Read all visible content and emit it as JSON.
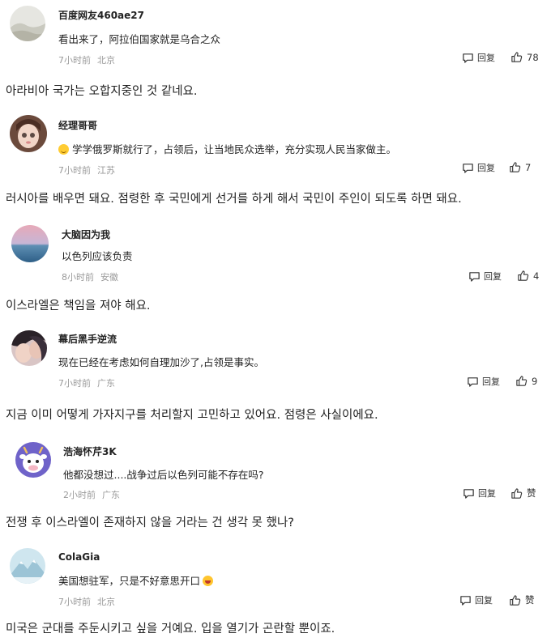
{
  "comments": [
    {
      "username": "百度网友460ae27",
      "text": "看出来了，阿拉伯国家就是乌合之众",
      "time": "7小时前",
      "location": "北京",
      "reply_label": "回复",
      "likes": "78",
      "translation": "아라비아 국가는 오합지중인 것 같네요."
    },
    {
      "username": "经理哥哥",
      "text": "学学俄罗斯就行了，占领后，让当地民众选举，充分实现人民当家做主。",
      "time": "7小时前",
      "location": "江苏",
      "reply_label": "回复",
      "likes": "7",
      "translation": "러시아를 배우면 돼요. 점령한 후 국민에게 선거를 하게 해서 국민이 주인이 되도록 하면 돼요."
    },
    {
      "username": "大脑因为我",
      "text": "以色列应该负责",
      "time": "8小时前",
      "location": "安徽",
      "reply_label": "回复",
      "likes": "4",
      "translation": "이스라엘은 책임을 져야 해요."
    },
    {
      "username": "幕后黑手逆流",
      "text": "现在已经在考虑如何自理加沙了,占领是事实。",
      "time": "7小时前",
      "location": "广东",
      "reply_label": "回复",
      "likes": "9",
      "translation": "지금 이미 어떻게 가자지구를 처리할지 고민하고 있어요. 점령은 사실이에요."
    },
    {
      "username": "浩海怀芹3K",
      "text": "他都没想过....战争过后以色列可能不存在吗?",
      "time": "2小时前",
      "location": "广东",
      "reply_label": "回复",
      "likes": "赞",
      "translation": "전쟁 후 이스라엘이 존재하지 않을 거라는 건 생각 못 했나?"
    },
    {
      "username": "ColaGia",
      "text": "美国想驻军，只是不好意思开口",
      "time": "7小时前",
      "location": "北京",
      "reply_label": "回复",
      "likes": "赞",
      "translation": "미국은 군대를 주둔시키고 싶을 거예요. 입을 열기가 곤란할 뿐이죠."
    }
  ]
}
